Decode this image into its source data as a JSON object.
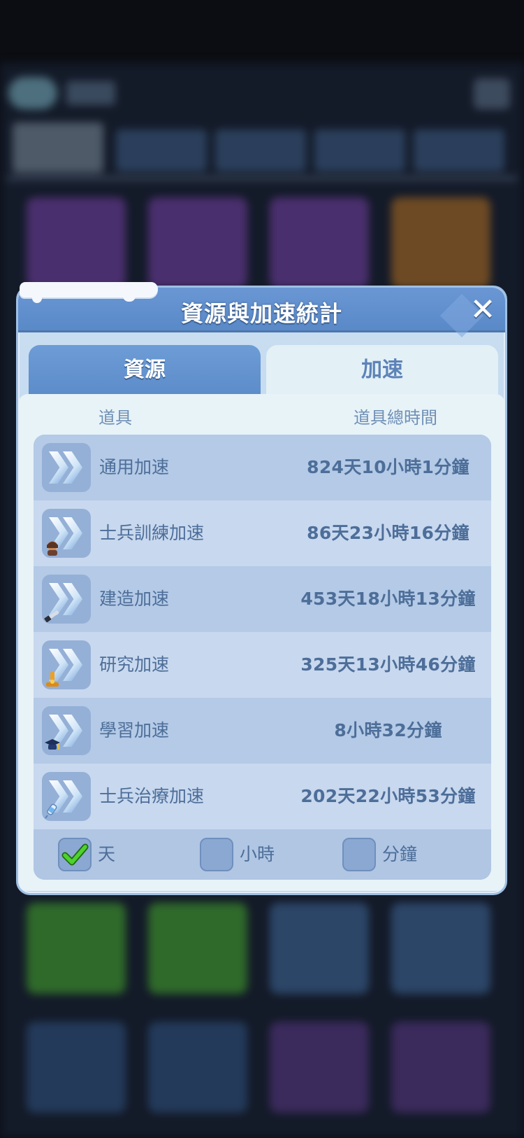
{
  "modal": {
    "title": "資源與加速統計",
    "close_icon": "✕"
  },
  "tabs": [
    {
      "label": "資源",
      "active": false
    },
    {
      "label": "加速",
      "active": true
    }
  ],
  "columns": {
    "items": "道具",
    "total_time": "道具總時間"
  },
  "rows": [
    {
      "name": "通用加速",
      "time": "824天10小時1分鐘",
      "icon": "speedup-general-icon"
    },
    {
      "name": "士兵訓練加速",
      "time": "86天23小時16分鐘",
      "icon": "speedup-training-icon"
    },
    {
      "name": "建造加速",
      "time": "453天18小時13分鐘",
      "icon": "speedup-construction-icon"
    },
    {
      "name": "研究加速",
      "time": "325天13小時46分鐘",
      "icon": "speedup-research-icon"
    },
    {
      "name": "學習加速",
      "time": "8小時32分鐘",
      "icon": "speedup-learning-icon"
    },
    {
      "name": "士兵治療加速",
      "time": "202天22小時53分鐘",
      "icon": "speedup-healing-icon"
    }
  ],
  "filters": [
    {
      "label": "天",
      "checked": true
    },
    {
      "label": "小時",
      "checked": false
    },
    {
      "label": "分鐘",
      "checked": false
    }
  ],
  "colors": {
    "header": "#5a89c8",
    "text": "#4d6e99",
    "check_green": "#3fbf2a"
  }
}
